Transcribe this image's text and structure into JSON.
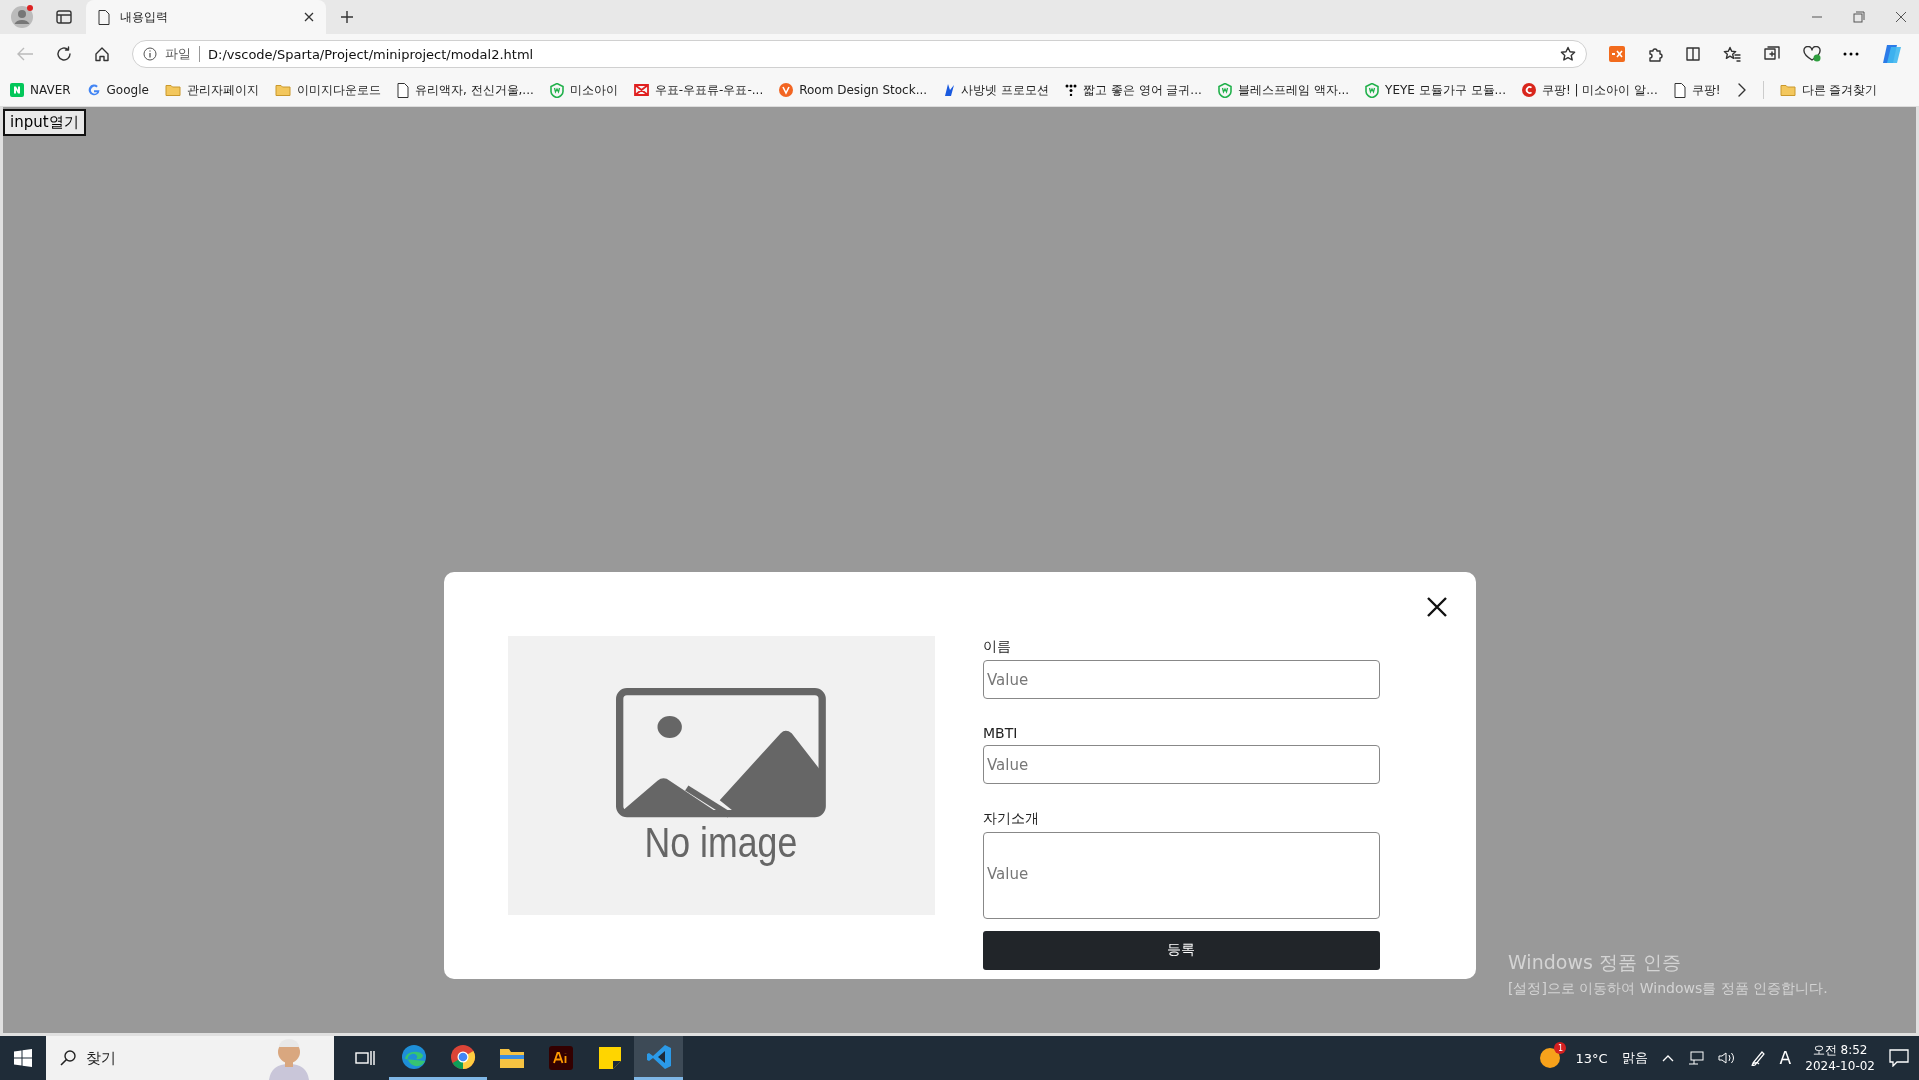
{
  "browser": {
    "tabs": [
      {
        "title": "내용입력",
        "selected": true
      }
    ],
    "address": {
      "scheme": "파일",
      "url": "D:/vscode/Sparta/Project/miniproject/modal2.html"
    },
    "bookmarks": [
      {
        "label": "NAVER",
        "kind": "naver"
      },
      {
        "label": "Google",
        "kind": "google"
      },
      {
        "label": "관리자페이지",
        "kind": "folder"
      },
      {
        "label": "이미지다운로드",
        "kind": "folder"
      },
      {
        "label": "유리액자, 전신거울,...",
        "kind": "page"
      },
      {
        "label": "미소아이",
        "kind": "shield"
      },
      {
        "label": "우표-우표류-우표-...",
        "kind": "redmark"
      },
      {
        "label": "Room Design Stock...",
        "kind": "orange"
      },
      {
        "label": "사방넷 프로모션",
        "kind": "bluemark"
      },
      {
        "label": "짧고 좋은 영어 글귀...",
        "kind": "dots"
      },
      {
        "label": "블레스프레임 액자...",
        "kind": "shield"
      },
      {
        "label": "YEYE 모듈가구 모듈...",
        "kind": "shield"
      },
      {
        "label": "쿠팡! | 미소아이 알...",
        "kind": "coupang"
      },
      {
        "label": "쿠팡!",
        "kind": "page"
      }
    ],
    "other_bookmarks": "다른 즐겨찾기"
  },
  "page": {
    "open_button": "input열기",
    "modal": {
      "image_caption": "No image",
      "fields": [
        {
          "label": "이름",
          "placeholder": "Value",
          "kind": "input"
        },
        {
          "label": "MBTI",
          "placeholder": "Value",
          "kind": "input"
        },
        {
          "label": "자기소개",
          "placeholder": "Value",
          "kind": "textarea"
        }
      ],
      "submit": "등록"
    }
  },
  "activation_notice": {
    "title": "Windows 정품 인증",
    "message": "[설정]으로 이동하여 Windows를 정품 인증합니다."
  },
  "taskbar": {
    "search_placeholder": "찾기",
    "apps": [
      {
        "kind": "taskview",
        "running": false,
        "selected": false
      },
      {
        "kind": "edge",
        "running": true,
        "selected": false
      },
      {
        "kind": "chrome",
        "running": true,
        "selected": false
      },
      {
        "kind": "explorer",
        "running": false,
        "selected": false
      },
      {
        "kind": "illustrator",
        "running": false,
        "selected": false
      },
      {
        "kind": "notes",
        "running": false,
        "selected": false
      },
      {
        "kind": "vscode",
        "running": true,
        "selected": true
      }
    ],
    "weather": {
      "badge": "1",
      "temperature": "13°C",
      "condition": "맑음"
    },
    "ime": "A",
    "time": "오전 8:52",
    "date": "2024-10-02"
  }
}
